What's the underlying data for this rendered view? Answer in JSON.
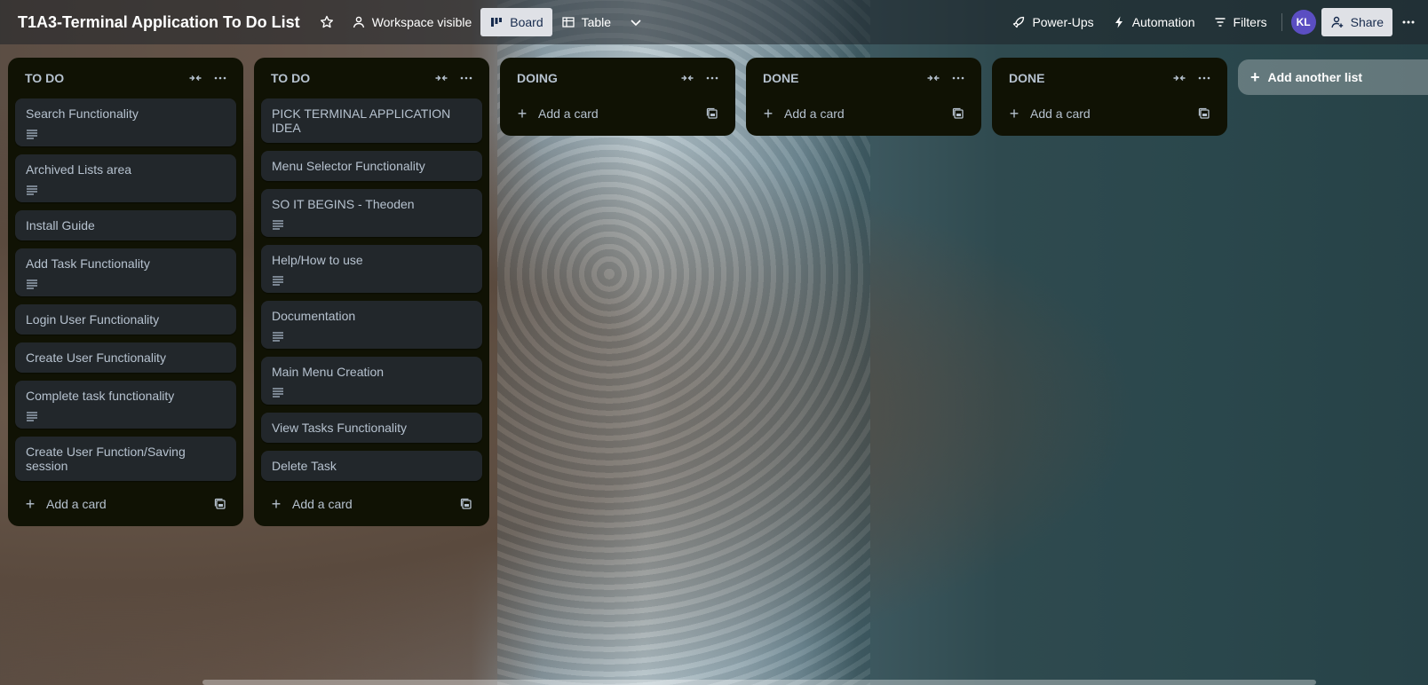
{
  "board": {
    "title": "T1A3-Terminal Application To Do List",
    "visibility_label": "Workspace visible",
    "views": [
      {
        "label": "Board"
      },
      {
        "label": "Table"
      }
    ],
    "power_ups_label": "Power-Ups",
    "automation_label": "Automation",
    "filters_label": "Filters",
    "avatar_initials": "KL",
    "share_label": "Share"
  },
  "lists": [
    {
      "title": "TO DO",
      "cards": [
        {
          "title": "Search Functionality",
          "has_description": true
        },
        {
          "title": "Archived Lists area",
          "has_description": true
        },
        {
          "title": "Install Guide",
          "has_description": false
        },
        {
          "title": "Add Task Functionality",
          "has_description": true
        },
        {
          "title": "Login User Functionality",
          "has_description": false
        },
        {
          "title": "Create User Functionality",
          "has_description": false
        },
        {
          "title": "Complete task functionality",
          "has_description": true
        },
        {
          "title": "Create User Function/Saving session",
          "has_description": false
        }
      ],
      "add_card_label": "Add a card"
    },
    {
      "title": "TO DO",
      "cards": [
        {
          "title": "PICK TERMINAL APPLICATION IDEA",
          "has_description": false
        },
        {
          "title": "Menu Selector Functionality",
          "has_description": false
        },
        {
          "title": "SO IT BEGINS - Theoden",
          "has_description": true
        },
        {
          "title": "Help/How to use",
          "has_description": true
        },
        {
          "title": "Documentation",
          "has_description": true
        },
        {
          "title": "Main Menu Creation",
          "has_description": true
        },
        {
          "title": "View Tasks Functionality",
          "has_description": false
        },
        {
          "title": "Delete Task",
          "has_description": false
        }
      ],
      "add_card_label": "Add a card"
    },
    {
      "title": "DOING",
      "cards": [],
      "add_card_label": "Add a card"
    },
    {
      "title": "DONE",
      "cards": [],
      "add_card_label": "Add a card"
    },
    {
      "title": "DONE",
      "cards": [],
      "add_card_label": "Add a card"
    }
  ],
  "add_list_label": "Add another list"
}
